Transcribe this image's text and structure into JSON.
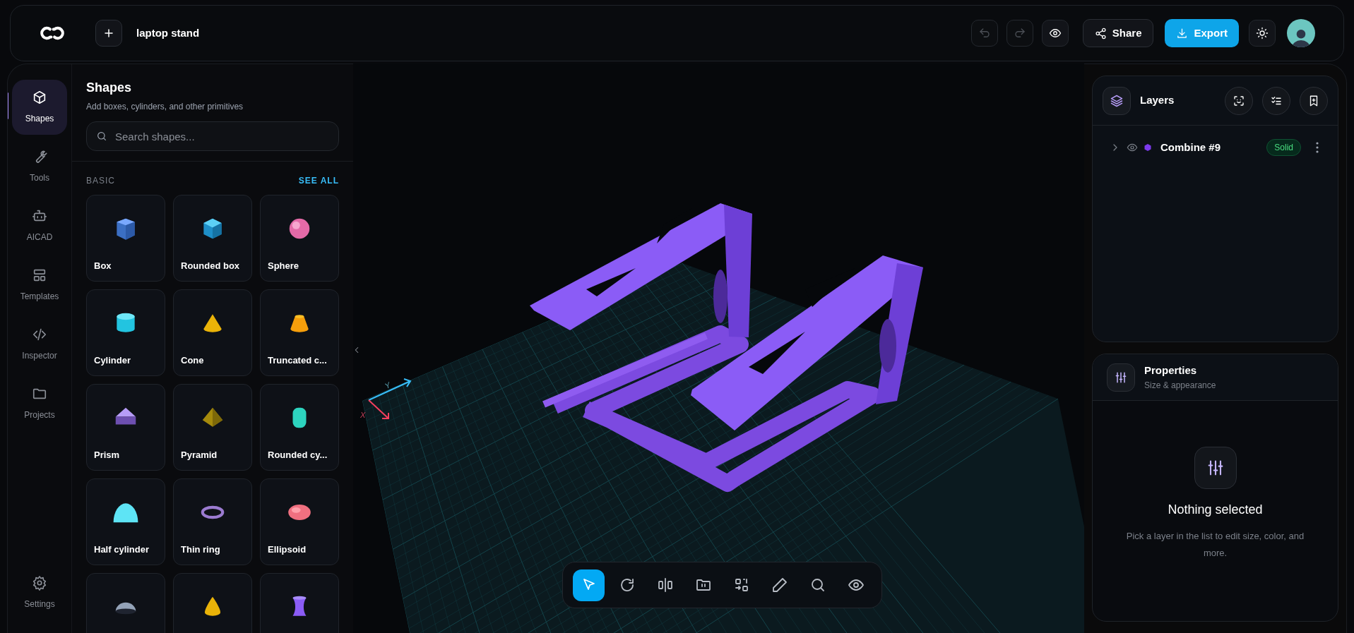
{
  "topbar": {
    "project_name": "laptop stand",
    "share_label": "Share",
    "export_label": "Export"
  },
  "nav": {
    "items": [
      {
        "label": "Shapes",
        "kind": "cube",
        "selected": true
      },
      {
        "label": "Tools",
        "kind": "wrench",
        "selected": false
      },
      {
        "label": "AICAD",
        "kind": "robot",
        "selected": false
      },
      {
        "label": "Templates",
        "kind": "layout",
        "selected": false
      },
      {
        "label": "Inspector",
        "kind": "code",
        "selected": false
      },
      {
        "label": "Projects",
        "kind": "folder",
        "selected": false
      }
    ],
    "settings": {
      "label": "Settings",
      "selected": false
    }
  },
  "shapes_panel": {
    "title": "Shapes",
    "subtitle": "Add boxes, cylinders, and other primitives",
    "search": {
      "placeholder": "Search shapes..."
    },
    "section": "BASIC",
    "see_all": "SEE ALL",
    "shapes": [
      {
        "label": "Box",
        "kind": "box"
      },
      {
        "label": "Rounded box",
        "kind": "rounded_box"
      },
      {
        "label": "Sphere",
        "kind": "sphere"
      },
      {
        "label": "Cylinder",
        "kind": "cylinder"
      },
      {
        "label": "Cone",
        "kind": "cone"
      },
      {
        "label": "Truncated c...",
        "kind": "truncated_cone"
      },
      {
        "label": "Prism",
        "kind": "prism"
      },
      {
        "label": "Pyramid",
        "kind": "pyramid"
      },
      {
        "label": "Rounded cy...",
        "kind": "rounded_cylinder"
      },
      {
        "label": "Half cylinder",
        "kind": "half_cylinder"
      },
      {
        "label": "Thin ring",
        "kind": "ring"
      },
      {
        "label": "Ellipsoid",
        "kind": "ellipsoid"
      },
      {
        "kind": "hemisphere"
      },
      {
        "kind": "paraboloid"
      },
      {
        "kind": "hyperboloid"
      }
    ]
  },
  "viewport": {
    "axes": [
      {
        "label": "Y",
        "kind": "y"
      },
      {
        "label": "X",
        "kind": "x"
      }
    ],
    "toolbar": [
      {
        "kind": "select",
        "selected": true
      },
      {
        "kind": "rotate",
        "selected": false
      },
      {
        "kind": "align",
        "selected": false
      },
      {
        "kind": "folder",
        "selected": false
      },
      {
        "kind": "swap",
        "selected": false
      },
      {
        "kind": "pencil",
        "selected": false
      },
      {
        "kind": "search",
        "selected": false
      },
      {
        "kind": "eye",
        "selected": false
      }
    ]
  },
  "layers": {
    "title": "Layers",
    "items": [
      {
        "name": "Combine #9",
        "badge": "Solid",
        "expanded": false,
        "color": "#7c3aed"
      }
    ]
  },
  "properties": {
    "title": "Properties",
    "subtitle": "Size & appearance",
    "empty_title": "Nothing selected",
    "empty_text": "Pick a layer in the list to edit size, color, and more."
  }
}
